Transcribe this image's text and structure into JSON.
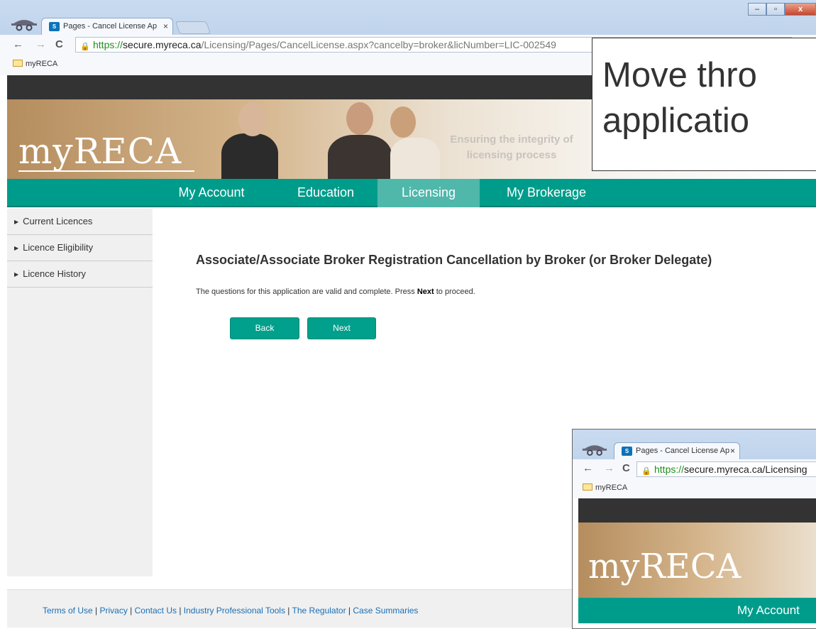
{
  "browser": {
    "tab_title": "Pages - Cancel License Ap",
    "tab_close": "×",
    "favicon": "S",
    "url_scheme": "https://",
    "url_host": "secure.myreca.ca",
    "url_path": "/Licensing/Pages/CancelLicense.aspx?cancelby=broker&licNumber=LIC-002549",
    "bookmark": "myRECA",
    "window_controls": {
      "minimize": "–",
      "maximize": "▫",
      "close": "x"
    },
    "nav_icons": {
      "back": "←",
      "forward": "→",
      "reload": "C"
    }
  },
  "site": {
    "logo": "myRECA",
    "tagline_line1": "Ensuring the integrity of",
    "tagline_line2": "licensing process",
    "nav": [
      "My Account",
      "Education",
      "Licensing",
      "My Brokerage"
    ],
    "active_nav": "Licensing"
  },
  "sidebar": {
    "items": [
      {
        "label": "Current Licences"
      },
      {
        "label": "Licence Eligibility"
      },
      {
        "label": "Licence History"
      }
    ]
  },
  "main": {
    "heading": "Associate/Associate Broker Registration Cancellation by Broker (or Broker Delegate)",
    "message_before": "The questions for this application are valid and complete. Press ",
    "message_bold": "Next",
    "message_after": " to proceed.",
    "back_label": "Back",
    "next_label": "Next"
  },
  "footer": {
    "links": [
      "Terms of Use",
      "Privacy",
      "Contact Us",
      "Industry Professional Tools",
      "The Regulator",
      "Case Summaries"
    ]
  },
  "callout": {
    "line1": "Move thro",
    "line2": "applicatio"
  },
  "inset": {
    "tab_title": "Pages - Cancel License Ap",
    "url_scheme": "https://",
    "url_rest": "secure.myreca.ca/Licensing",
    "bookmark": "myRECA",
    "logo": "myRECA",
    "nav_item": "My Account"
  },
  "colors": {
    "brand_teal": "#009c8b",
    "active_nav": "#50b7ab",
    "dark_bar": "#333333"
  }
}
